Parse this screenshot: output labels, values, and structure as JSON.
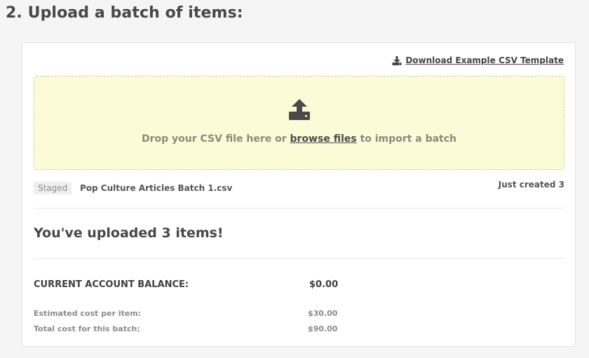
{
  "section": {
    "title": "2. Upload a batch of items:"
  },
  "download": {
    "label": "Download Example CSV Template",
    "icon": "download-icon"
  },
  "dropzone": {
    "icon": "upload-icon",
    "text_before": "Drop your CSV file here or ",
    "link": "browse files",
    "text_after": " to import a batch"
  },
  "staged": {
    "badge": "Staged",
    "file_name": "Pop Culture Articles Batch 1.csv",
    "status": "Just created 3"
  },
  "summary": {
    "heading": "You've uploaded 3 items!",
    "balance_label": "CURRENT ACCOUNT BALANCE:",
    "balance_value": "$0.00",
    "cost_per_item_label": "Estimated cost per item:",
    "cost_per_item_value": "$30.00",
    "total_cost_label": "Total cost for this batch:",
    "total_cost_value": "$90.00"
  },
  "colors": {
    "dropzone_bg": "#fbfbd8",
    "text_dark": "#474747",
    "text_muted": "#8a8a8a"
  }
}
